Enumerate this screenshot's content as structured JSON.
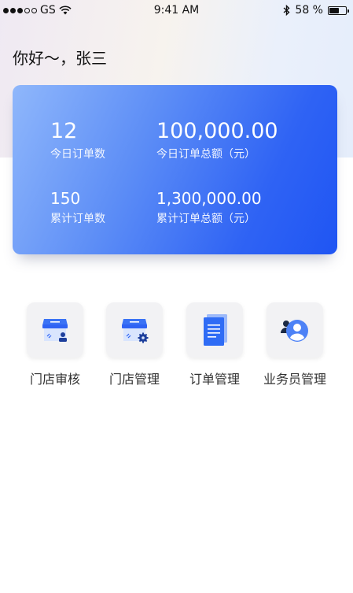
{
  "status_bar": {
    "carrier": "GS",
    "time": "9:41 AM",
    "battery_text": "58 %",
    "battery_level": 0.58
  },
  "greeting": "你好～，张三",
  "stats": [
    {
      "value": "12",
      "label": "今日订单数"
    },
    {
      "value": "100,000.00",
      "label": "今日订单总额（元）"
    },
    {
      "value": "150",
      "label": "累计订单数"
    },
    {
      "value": "1,300,000.00",
      "label": "累计订单总额（元）"
    }
  ],
  "actions": [
    {
      "label": "门店审核",
      "icon": "store-review-icon"
    },
    {
      "label": "门店管理",
      "icon": "store-settings-icon"
    },
    {
      "label": "订单管理",
      "icon": "document-icon"
    },
    {
      "label": "业务员管理",
      "icon": "users-icon"
    }
  ],
  "colors": {
    "card_start": "#8fb7fb",
    "card_end": "#1f55f3",
    "icon_blue": "#2f6cf5"
  }
}
